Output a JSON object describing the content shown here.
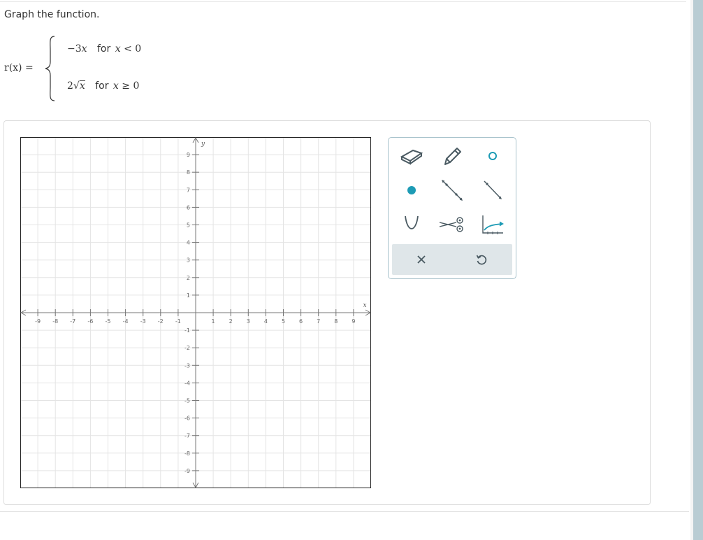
{
  "prompt": "Graph the function.",
  "function": {
    "label": "r(x) =",
    "case1": {
      "expr_coef": "−3",
      "expr_var": "x",
      "word": "for",
      "cond_var": "x",
      "cond_rel": "< 0"
    },
    "case2": {
      "expr_coef": "2",
      "expr_var": "x",
      "word": "for",
      "cond_var": "x",
      "cond_rel": "≥ 0"
    }
  },
  "graph": {
    "x_min": -10,
    "x_max": 10,
    "y_min": -10,
    "y_max": 10,
    "x_ticks": [
      "-9",
      "-8",
      "-7",
      "-6",
      "-5",
      "-4",
      "-3",
      "-2",
      "-1",
      "1",
      "2",
      "3",
      "4",
      "5",
      "6",
      "7",
      "8",
      "9"
    ],
    "y_ticks": [
      "9",
      "8",
      "7",
      "6",
      "5",
      "4",
      "3",
      "2",
      "1",
      "-1",
      "-2",
      "-3",
      "-4",
      "-5",
      "-6",
      "-7",
      "-8",
      "-9"
    ],
    "x_axis_label": "x",
    "y_axis_label": "y",
    "grid": true,
    "grid_step": 1
  },
  "toolbox": {
    "tools": [
      {
        "name": "eraser-icon"
      },
      {
        "name": "pencil-icon"
      },
      {
        "name": "open-circle-icon"
      },
      {
        "name": "closed-point-icon"
      },
      {
        "name": "line-icon"
      },
      {
        "name": "ray-icon"
      },
      {
        "name": "parabola-icon"
      },
      {
        "name": "scissors-icon"
      },
      {
        "name": "curve-graph-icon"
      }
    ],
    "actions": [
      {
        "name": "clear-icon"
      },
      {
        "name": "undo-icon"
      }
    ],
    "accent_color": "#1d9bb5",
    "icon_color": "#4a5a62"
  }
}
